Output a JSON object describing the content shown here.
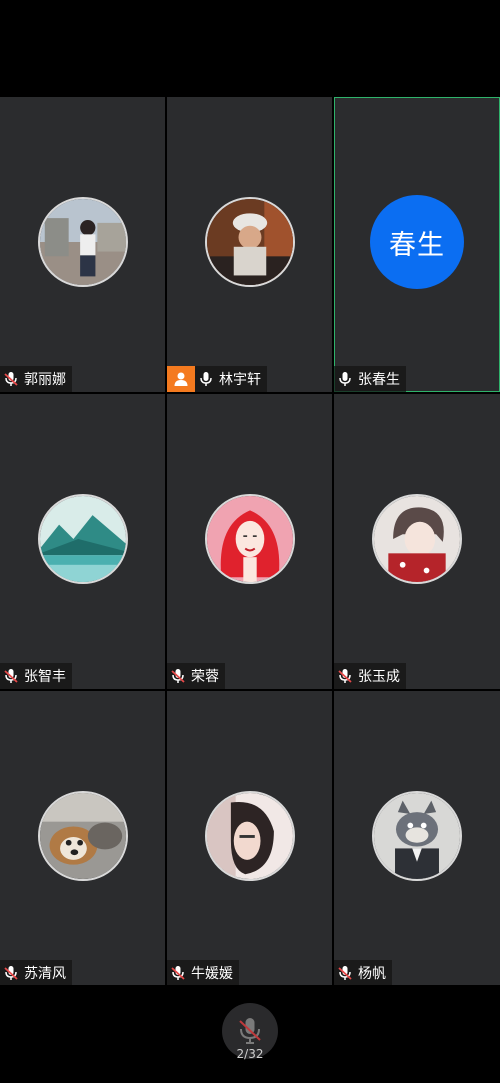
{
  "participants": [
    {
      "name": "郭丽娜",
      "muted": true,
      "host": false,
      "active": false,
      "avatar": "photo-woman-standing"
    },
    {
      "name": "林宇轩",
      "muted": false,
      "host": true,
      "active": false,
      "avatar": "photo-man-cap"
    },
    {
      "name": "张春生",
      "muted": false,
      "host": false,
      "active": true,
      "avatar_text": "春生"
    },
    {
      "name": "张智丰",
      "muted": true,
      "host": false,
      "active": false,
      "avatar": "photo-lake-mountains"
    },
    {
      "name": "荣蓉",
      "muted": true,
      "host": false,
      "active": false,
      "avatar": "illustration-red-hair-woman"
    },
    {
      "name": "张玉成",
      "muted": true,
      "host": false,
      "active": false,
      "avatar": "anime-boy"
    },
    {
      "name": "苏清风",
      "muted": true,
      "host": false,
      "active": false,
      "avatar": "photo-dog"
    },
    {
      "name": "牛媛媛",
      "muted": true,
      "host": false,
      "active": false,
      "avatar": "photo-girl-face"
    },
    {
      "name": "杨帆",
      "muted": true,
      "host": false,
      "active": false,
      "avatar": "cartoon-cat-suit"
    }
  ],
  "bottom": {
    "page_indicator": "2/32",
    "mute_icon": "mic-muted-icon"
  },
  "colors": {
    "active_border": "#2fb36b",
    "host_badge": "#f47a1f",
    "text_avatar_bg": "#0b6ef2",
    "muted_mic": "#e84a4a"
  }
}
